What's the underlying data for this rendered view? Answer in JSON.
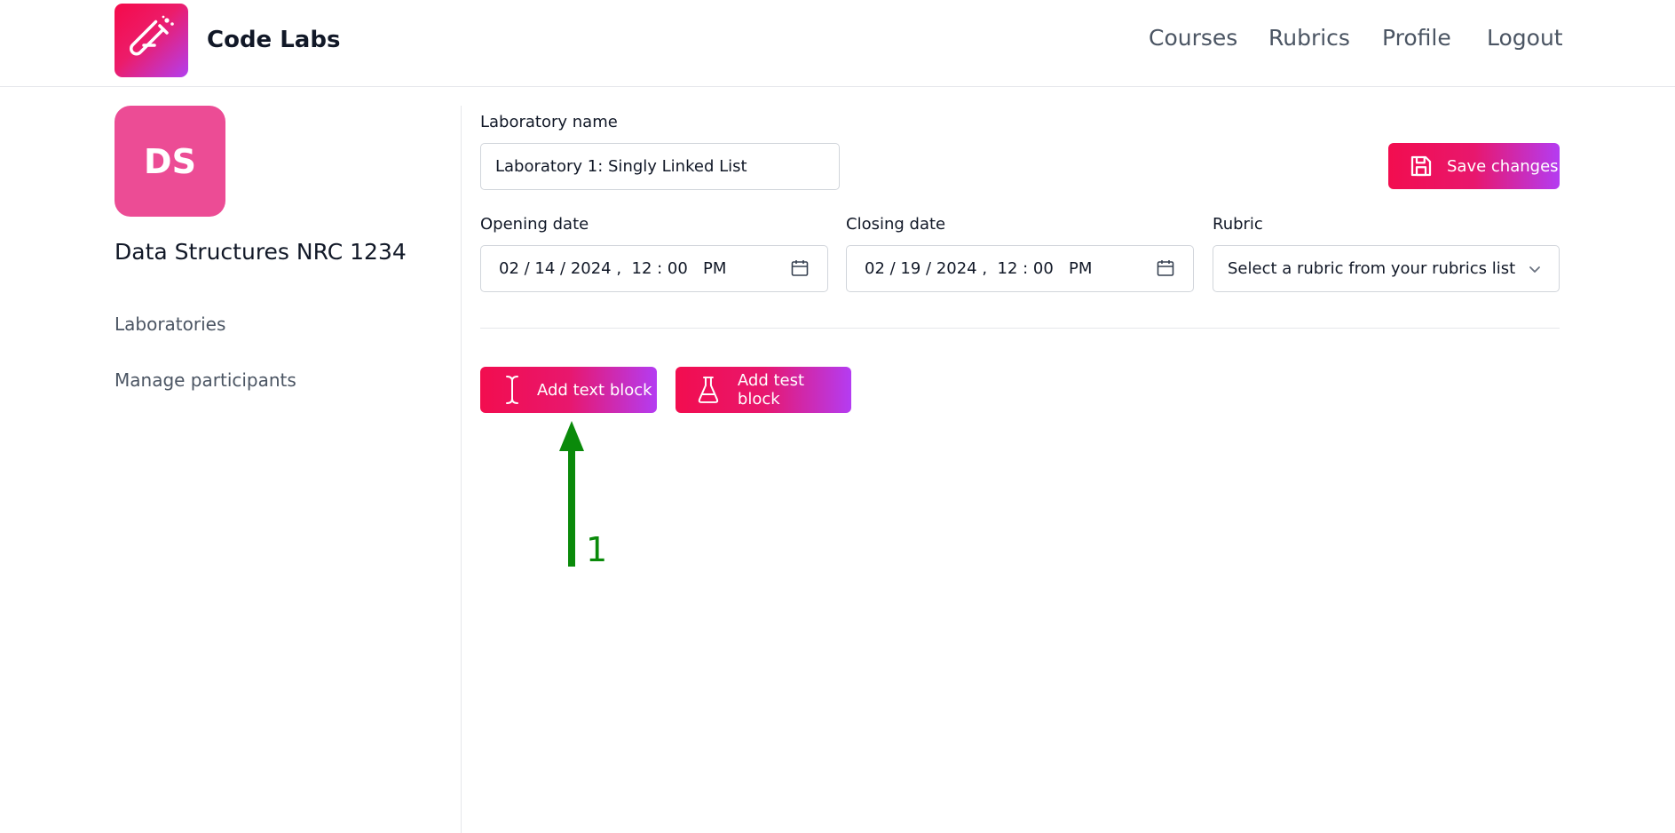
{
  "header": {
    "brand": "Code Labs",
    "nav": [
      "Courses",
      "Rubrics",
      "Profile",
      "Logout"
    ]
  },
  "sidebar": {
    "avatar_initials": "DS",
    "course_title": "Data Structures NRC 1234",
    "links": [
      "Laboratories",
      "Manage participants"
    ]
  },
  "form": {
    "lab_name_label": "Laboratory name",
    "lab_name_value": "Laboratory 1: Singly Linked List",
    "save_label": "Save changes",
    "opening_label": "Opening date",
    "opening_value": "02 / 14 / 2024 ,  12 : 00   PM",
    "closing_label": "Closing date",
    "closing_value": "02 / 19 / 2024 ,  12 : 00   PM",
    "rubric_label": "Rubric",
    "rubric_value": "Select a rubric from your rubrics list"
  },
  "blocks": {
    "add_text_label": "Add text block",
    "add_test_label": "Add test block"
  },
  "annotation": {
    "number": "1",
    "color": "#0a8a0a"
  },
  "colors": {
    "gradient_start": "#f20d4f",
    "gradient_end": "#b43cf2",
    "avatar": "#ec4c95"
  }
}
